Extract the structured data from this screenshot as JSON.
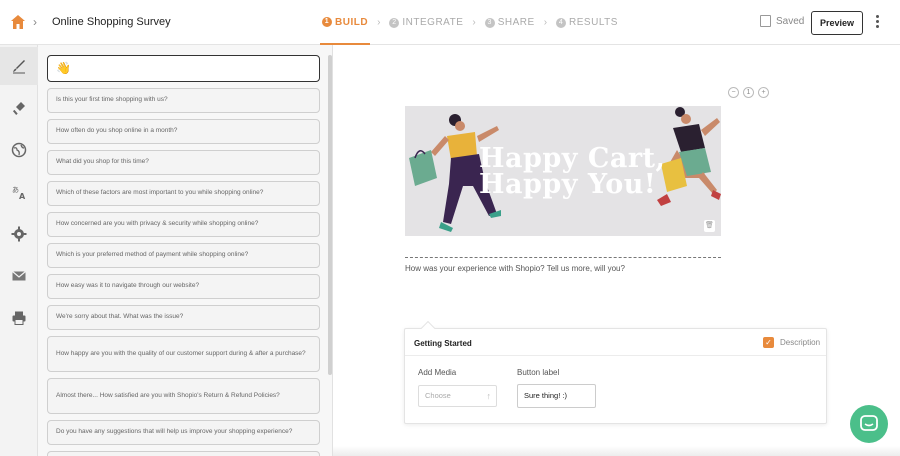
{
  "header": {
    "survey_title": "Online Shopping Survey",
    "steps": [
      {
        "num": "1",
        "label": "BUILD",
        "active": true
      },
      {
        "num": "2",
        "label": "INTEGRATE",
        "active": false
      },
      {
        "num": "3",
        "label": "SHARE",
        "active": false
      },
      {
        "num": "4",
        "label": "RESULTS",
        "active": false
      }
    ],
    "saved_label": "Saved",
    "preview_label": "Preview"
  },
  "rail": {
    "items": [
      "brush-icon",
      "paint-roller-icon",
      "globe-icon",
      "translate-icon",
      "gear-icon",
      "mail-icon",
      "printer-icon"
    ]
  },
  "questions": [
    {
      "text": "👋"
    },
    {
      "text": "Is this your first time shopping with us?"
    },
    {
      "text": "How often do you shop online in a month?"
    },
    {
      "text": "What did you shop for this time?"
    },
    {
      "text": "Which of these factors are most important to you while shopping online?"
    },
    {
      "text": "How concerned are you with privacy & security while shopping online?"
    },
    {
      "text": "Which is your preferred method of payment while shopping online?"
    },
    {
      "text": "How easy was it to navigate through our website?"
    },
    {
      "text": "We're sorry about that. What was the issue?"
    },
    {
      "text": "How happy are you with the quality of our customer support during & after a purchase?"
    },
    {
      "text": "Almost there... How satisfied are you with Shopio's Return & Refund Policies?"
    },
    {
      "text": "Do you have any suggestions that will help us improve your shopping experience?"
    }
  ],
  "canvas": {
    "hero_line1": "Happy Cart,",
    "hero_line2": "Happy You!",
    "question_text": "How was your experience with Shopio? Tell us more, will you?",
    "mini_controls": [
      "−",
      "1",
      "+"
    ]
  },
  "settings": {
    "title": "Getting Started",
    "description_label": "Description",
    "add_media_label": "Add Media",
    "media_placeholder": "Choose",
    "button_label_label": "Button label",
    "button_label_value": "Sure thing! :)"
  },
  "colors": {
    "accent": "#e88a3c",
    "chat": "#4bbf8a"
  }
}
